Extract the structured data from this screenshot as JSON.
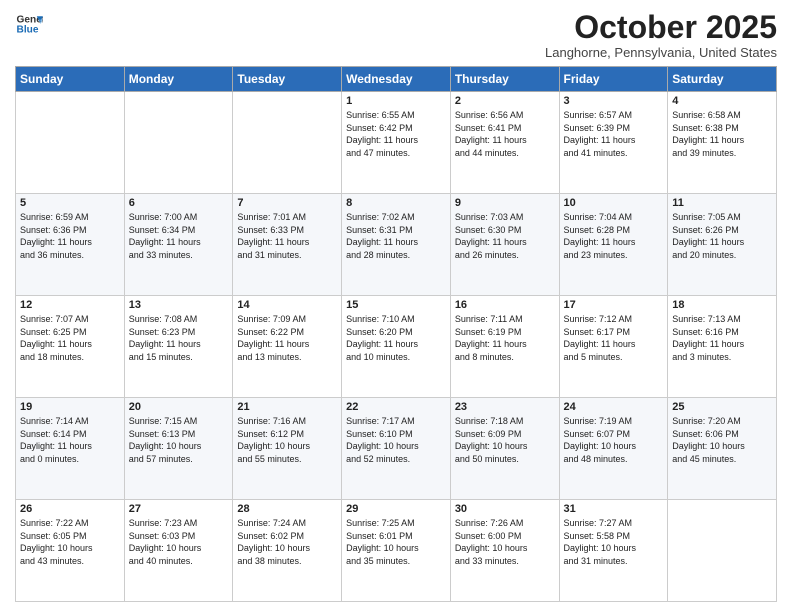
{
  "header": {
    "logo_line1": "General",
    "logo_line2": "Blue",
    "month": "October 2025",
    "location": "Langhorne, Pennsylvania, United States"
  },
  "days_of_week": [
    "Sunday",
    "Monday",
    "Tuesday",
    "Wednesday",
    "Thursday",
    "Friday",
    "Saturday"
  ],
  "weeks": [
    [
      {
        "day": "",
        "info": ""
      },
      {
        "day": "",
        "info": ""
      },
      {
        "day": "",
        "info": ""
      },
      {
        "day": "1",
        "info": "Sunrise: 6:55 AM\nSunset: 6:42 PM\nDaylight: 11 hours\nand 47 minutes."
      },
      {
        "day": "2",
        "info": "Sunrise: 6:56 AM\nSunset: 6:41 PM\nDaylight: 11 hours\nand 44 minutes."
      },
      {
        "day": "3",
        "info": "Sunrise: 6:57 AM\nSunset: 6:39 PM\nDaylight: 11 hours\nand 41 minutes."
      },
      {
        "day": "4",
        "info": "Sunrise: 6:58 AM\nSunset: 6:38 PM\nDaylight: 11 hours\nand 39 minutes."
      }
    ],
    [
      {
        "day": "5",
        "info": "Sunrise: 6:59 AM\nSunset: 6:36 PM\nDaylight: 11 hours\nand 36 minutes."
      },
      {
        "day": "6",
        "info": "Sunrise: 7:00 AM\nSunset: 6:34 PM\nDaylight: 11 hours\nand 33 minutes."
      },
      {
        "day": "7",
        "info": "Sunrise: 7:01 AM\nSunset: 6:33 PM\nDaylight: 11 hours\nand 31 minutes."
      },
      {
        "day": "8",
        "info": "Sunrise: 7:02 AM\nSunset: 6:31 PM\nDaylight: 11 hours\nand 28 minutes."
      },
      {
        "day": "9",
        "info": "Sunrise: 7:03 AM\nSunset: 6:30 PM\nDaylight: 11 hours\nand 26 minutes."
      },
      {
        "day": "10",
        "info": "Sunrise: 7:04 AM\nSunset: 6:28 PM\nDaylight: 11 hours\nand 23 minutes."
      },
      {
        "day": "11",
        "info": "Sunrise: 7:05 AM\nSunset: 6:26 PM\nDaylight: 11 hours\nand 20 minutes."
      }
    ],
    [
      {
        "day": "12",
        "info": "Sunrise: 7:07 AM\nSunset: 6:25 PM\nDaylight: 11 hours\nand 18 minutes."
      },
      {
        "day": "13",
        "info": "Sunrise: 7:08 AM\nSunset: 6:23 PM\nDaylight: 11 hours\nand 15 minutes."
      },
      {
        "day": "14",
        "info": "Sunrise: 7:09 AM\nSunset: 6:22 PM\nDaylight: 11 hours\nand 13 minutes."
      },
      {
        "day": "15",
        "info": "Sunrise: 7:10 AM\nSunset: 6:20 PM\nDaylight: 11 hours\nand 10 minutes."
      },
      {
        "day": "16",
        "info": "Sunrise: 7:11 AM\nSunset: 6:19 PM\nDaylight: 11 hours\nand 8 minutes."
      },
      {
        "day": "17",
        "info": "Sunrise: 7:12 AM\nSunset: 6:17 PM\nDaylight: 11 hours\nand 5 minutes."
      },
      {
        "day": "18",
        "info": "Sunrise: 7:13 AM\nSunset: 6:16 PM\nDaylight: 11 hours\nand 3 minutes."
      }
    ],
    [
      {
        "day": "19",
        "info": "Sunrise: 7:14 AM\nSunset: 6:14 PM\nDaylight: 11 hours\nand 0 minutes."
      },
      {
        "day": "20",
        "info": "Sunrise: 7:15 AM\nSunset: 6:13 PM\nDaylight: 10 hours\nand 57 minutes."
      },
      {
        "day": "21",
        "info": "Sunrise: 7:16 AM\nSunset: 6:12 PM\nDaylight: 10 hours\nand 55 minutes."
      },
      {
        "day": "22",
        "info": "Sunrise: 7:17 AM\nSunset: 6:10 PM\nDaylight: 10 hours\nand 52 minutes."
      },
      {
        "day": "23",
        "info": "Sunrise: 7:18 AM\nSunset: 6:09 PM\nDaylight: 10 hours\nand 50 minutes."
      },
      {
        "day": "24",
        "info": "Sunrise: 7:19 AM\nSunset: 6:07 PM\nDaylight: 10 hours\nand 48 minutes."
      },
      {
        "day": "25",
        "info": "Sunrise: 7:20 AM\nSunset: 6:06 PM\nDaylight: 10 hours\nand 45 minutes."
      }
    ],
    [
      {
        "day": "26",
        "info": "Sunrise: 7:22 AM\nSunset: 6:05 PM\nDaylight: 10 hours\nand 43 minutes."
      },
      {
        "day": "27",
        "info": "Sunrise: 7:23 AM\nSunset: 6:03 PM\nDaylight: 10 hours\nand 40 minutes."
      },
      {
        "day": "28",
        "info": "Sunrise: 7:24 AM\nSunset: 6:02 PM\nDaylight: 10 hours\nand 38 minutes."
      },
      {
        "day": "29",
        "info": "Sunrise: 7:25 AM\nSunset: 6:01 PM\nDaylight: 10 hours\nand 35 minutes."
      },
      {
        "day": "30",
        "info": "Sunrise: 7:26 AM\nSunset: 6:00 PM\nDaylight: 10 hours\nand 33 minutes."
      },
      {
        "day": "31",
        "info": "Sunrise: 7:27 AM\nSunset: 5:58 PM\nDaylight: 10 hours\nand 31 minutes."
      },
      {
        "day": "",
        "info": ""
      }
    ]
  ]
}
